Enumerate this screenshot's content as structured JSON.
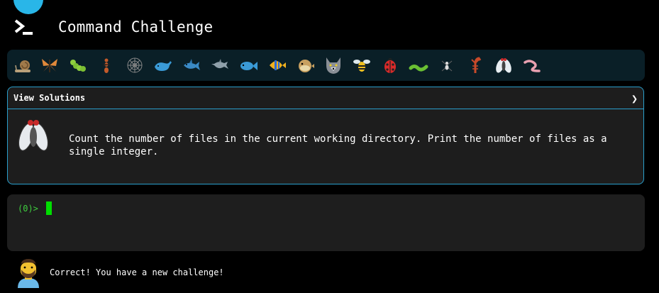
{
  "app": {
    "title": "Command Challenge"
  },
  "critters": [
    {
      "name": "snail-icon"
    },
    {
      "name": "butterfly-icon"
    },
    {
      "name": "caterpillar-icon"
    },
    {
      "name": "ant-icon"
    },
    {
      "name": "spider-web-icon"
    },
    {
      "name": "whale-icon"
    },
    {
      "name": "shark-icon"
    },
    {
      "name": "dolphin-icon"
    },
    {
      "name": "fish-icon"
    },
    {
      "name": "tropical-fish-icon"
    },
    {
      "name": "blowfish-icon"
    },
    {
      "name": "wolf-icon"
    },
    {
      "name": "bee-icon"
    },
    {
      "name": "ladybug-icon"
    },
    {
      "name": "worm-icon"
    },
    {
      "name": "spider-icon"
    },
    {
      "name": "scorpion-icon"
    },
    {
      "name": "fly-icon"
    },
    {
      "name": "earthworm-icon"
    }
  ],
  "challenge": {
    "header": "View Solutions",
    "chevron": "❯",
    "text": "Count the number of files in the current working directory. Print the number of files as a single integer."
  },
  "terminal": {
    "prompt": "(0)>"
  },
  "status": {
    "message": "Correct! You have a new challenge!"
  },
  "colors": {
    "accent": "#2a9fcc",
    "terminal_green": "#00dd00",
    "background": "#000000"
  }
}
